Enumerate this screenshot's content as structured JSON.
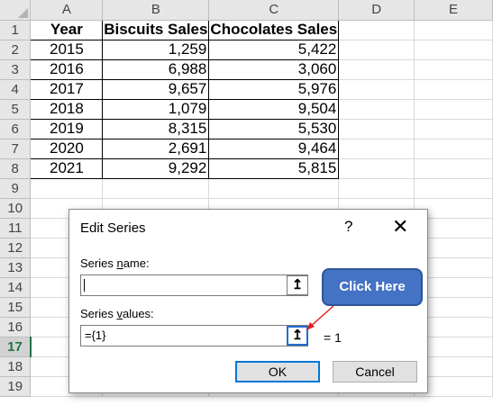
{
  "sheet": {
    "columns": [
      "A",
      "B",
      "C",
      "D",
      "E"
    ],
    "rows": [
      "1",
      "2",
      "3",
      "4",
      "5",
      "6",
      "7",
      "8",
      "9",
      "10",
      "11",
      "12",
      "13",
      "14",
      "15",
      "16",
      "17",
      "18",
      "19"
    ],
    "selected_row": "17",
    "headers": {
      "year": "Year",
      "biscuits": "Biscuits Sales",
      "chocolates": "Chocolates Sales"
    },
    "data": [
      {
        "year": "2015",
        "biscuits": "1,259",
        "chocolates": "5,422"
      },
      {
        "year": "2016",
        "biscuits": "6,988",
        "chocolates": "3,060"
      },
      {
        "year": "2017",
        "biscuits": "9,657",
        "chocolates": "5,976"
      },
      {
        "year": "2018",
        "biscuits": "1,079",
        "chocolates": "9,504"
      },
      {
        "year": "2019",
        "biscuits": "8,315",
        "chocolates": "5,530"
      },
      {
        "year": "2020",
        "biscuits": "2,691",
        "chocolates": "9,464"
      },
      {
        "year": "2021",
        "biscuits": "9,292",
        "chocolates": "5,815"
      }
    ]
  },
  "dialog": {
    "title": "Edit Series",
    "help": "?",
    "close": "✕",
    "series_name_label": "Series name:",
    "series_name_value": "",
    "series_values_label": "Series values:",
    "series_values_value": "={1}",
    "series_values_result": "= 1",
    "ref_icon": "collapse-dialog-icon",
    "ok_label": "OK",
    "cancel_label": "Cancel"
  },
  "callout": {
    "label": "Click Here",
    "color": "#4472c4"
  }
}
